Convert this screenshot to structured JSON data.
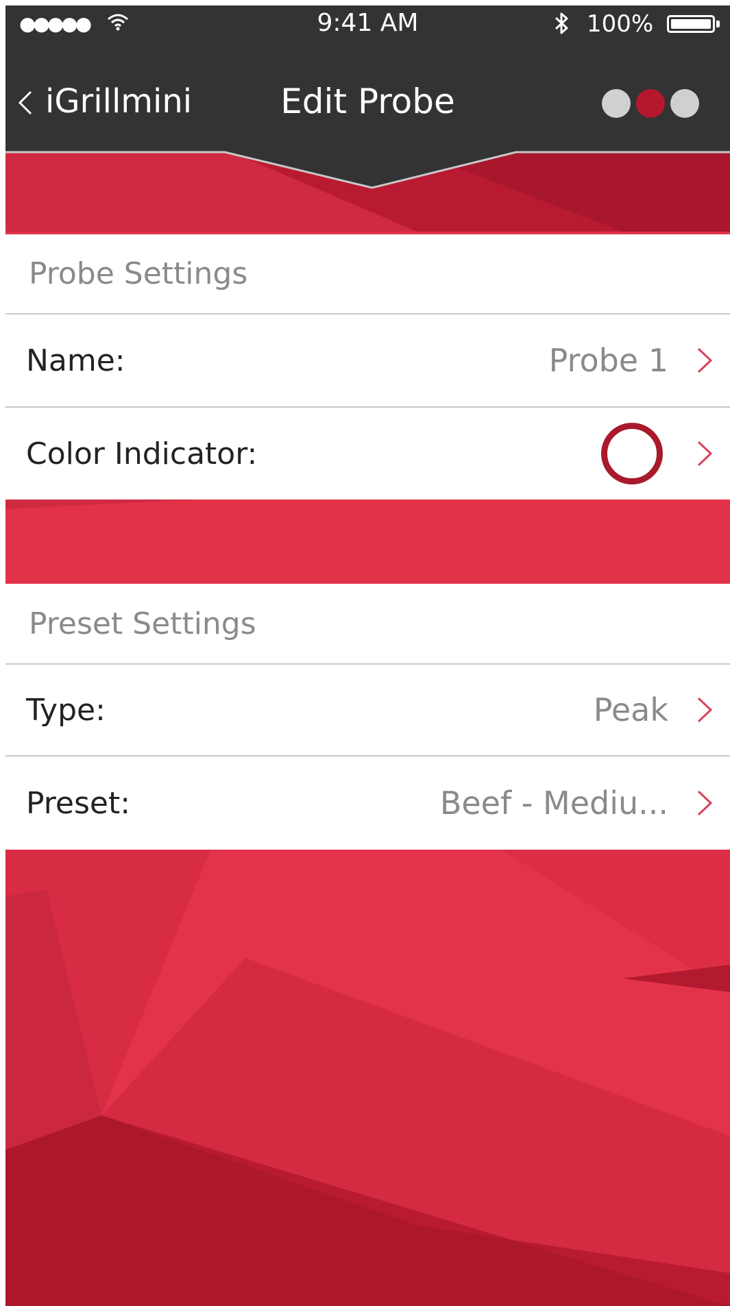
{
  "status_bar": {
    "signal": "●●●●●",
    "time": "9:41 AM",
    "battery_percent": "100%"
  },
  "nav": {
    "back_label": "iGrillmini",
    "title": "Edit Probe",
    "page_dots": {
      "count": 3,
      "active_index": 1
    }
  },
  "probe_settings": {
    "header": "Probe Settings",
    "name_label": "Name:",
    "name_value": "Probe 1",
    "color_label": "Color Indicator:",
    "color_value": "#a81a2c"
  },
  "preset_settings": {
    "header": "Preset Settings",
    "type_label": "Type:",
    "type_value": "Peak",
    "preset_label": "Preset:",
    "preset_value": "Beef - Mediu..."
  },
  "colors": {
    "nav_bar": "#333333",
    "accent_red": "#e0324b",
    "dark_red": "#a81a2c",
    "chevron": "#d8435a"
  }
}
